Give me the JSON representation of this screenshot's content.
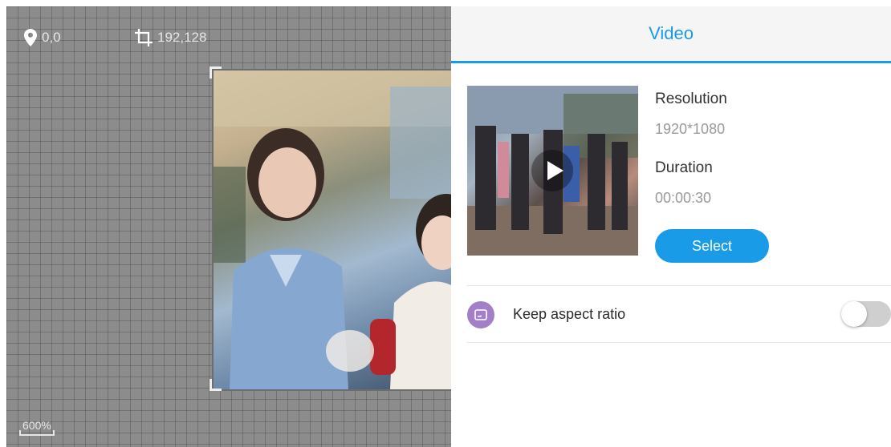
{
  "canvas": {
    "position_label": "0,0",
    "size_label": "192,128",
    "zoom_label": "600%"
  },
  "icons": {
    "position": "location-pin-icon",
    "size": "crop-icon",
    "play": "play-icon",
    "aspect": "aspect-ratio-icon"
  },
  "panel": {
    "title": "Video",
    "resolution_label": "Resolution",
    "resolution_value": "1920*1080",
    "duration_label": "Duration",
    "duration_value": "00:00:30",
    "select_label": "Select",
    "keep_aspect_label": "Keep aspect ratio",
    "keep_aspect_on": false
  },
  "colors": {
    "accent": "#1a9be8",
    "aspect_icon_bg": "#a27fc6",
    "canvas_bg": "#8c8c8c"
  }
}
